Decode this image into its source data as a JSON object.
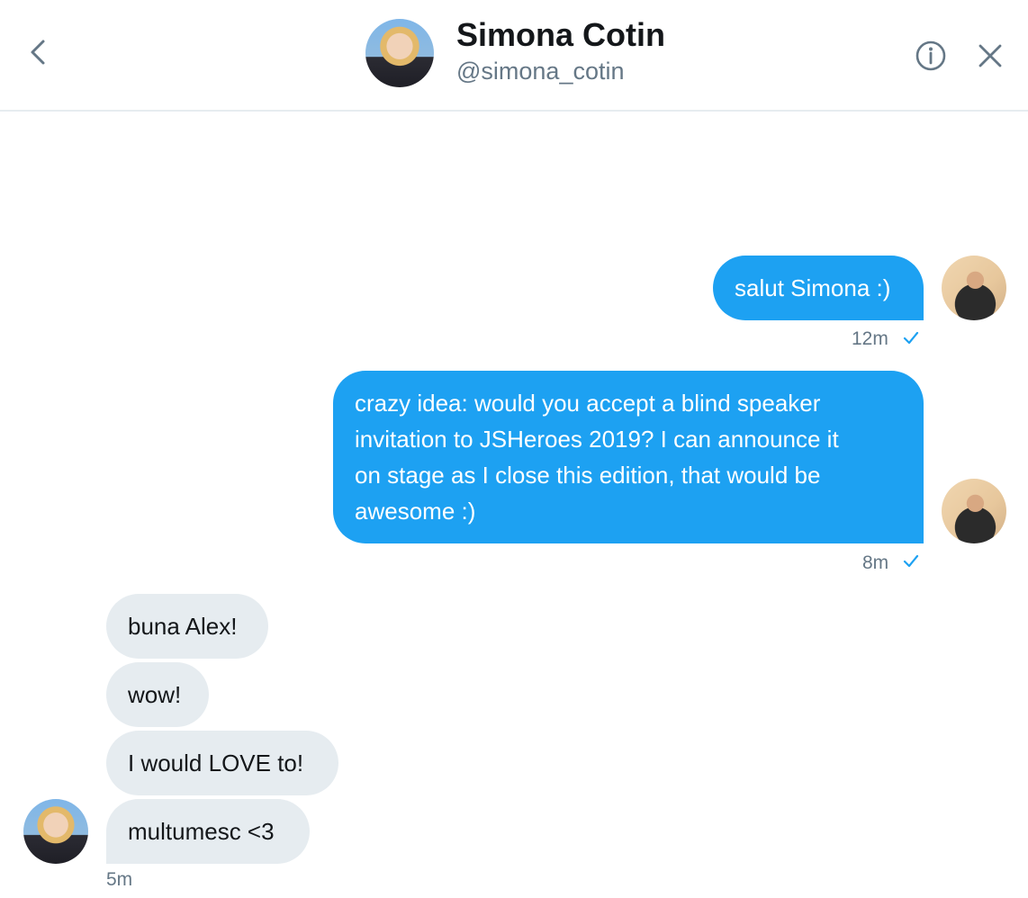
{
  "header": {
    "name": "Simona Cotin",
    "handle": "@simona_cotin",
    "back_icon": "chevron-left-icon",
    "info_icon": "info-circle-icon",
    "close_icon": "close-icon"
  },
  "messages": {
    "out1": {
      "text": "salut Simona :)",
      "time": "12m"
    },
    "out2": {
      "lines": [
        "crazy idea: would you accept a blind speaker",
        "invitation to JSHeroes 2019? I can announce it",
        "on stage as I close this edition, that would be",
        "awesome :)"
      ],
      "time": "8m"
    },
    "in": [
      {
        "text": "buna Alex!"
      },
      {
        "text": "wow!"
      },
      {
        "text": "I would LOVE to!"
      },
      {
        "text": "multumesc <3"
      }
    ],
    "in_time": "5m"
  },
  "colors": {
    "accent": "#1da1f2",
    "incoming_bubble": "#e6ecf0",
    "muted_text": "#657786"
  }
}
